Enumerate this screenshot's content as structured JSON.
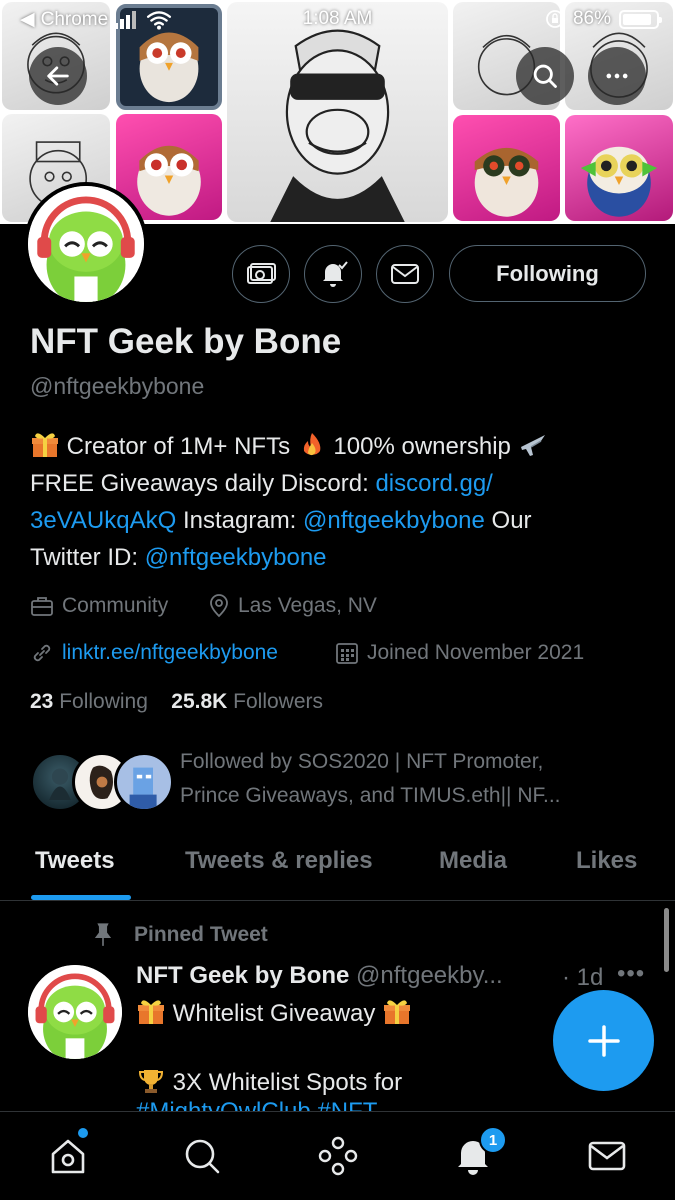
{
  "status_bar": {
    "back_app": "Chrome",
    "time": "1:08 AM",
    "battery": "86%",
    "battery_level": 0.86
  },
  "profile": {
    "name": "NFT Geek by Bone",
    "handle": "@nftgeekbybone",
    "following_button": "Following",
    "bio": {
      "line1_text1": "Creator of 1M+ NFTs",
      "line1_text2": "100% ownership",
      "line2_text": "FREE Giveaways daily Discord:",
      "discord_link_part1": "discord.gg/",
      "discord_link_part2": "3eVAUkqAkQ",
      "instagram_label": "Instagram:",
      "instagram_handle": "@nftgeekbybone",
      "our_label": "Our",
      "twitter_label": "Twitter ID:",
      "twitter_handle": "@nftgeekbybone"
    },
    "category": "Community",
    "location": "Las Vegas, NV",
    "website": "linktr.ee/nftgeekbybone",
    "joined": "Joined November 2021",
    "following_count": "23",
    "following_label": "Following",
    "followers_count": "25.8K",
    "followers_label": "Followers",
    "followed_by_line1": "Followed by SOS2020 | NFT Promoter,",
    "followed_by_line2": "Prince Giveaways, and TIMUS.eth|| NF..."
  },
  "tabs": [
    {
      "label": "Tweets",
      "active": true
    },
    {
      "label": "Tweets & replies",
      "active": false
    },
    {
      "label": "Media",
      "active": false
    },
    {
      "label": "Likes",
      "active": false
    }
  ],
  "pinned_tweet": {
    "pinned_label": "Pinned Tweet",
    "author_name": "NFT Geek by Bone",
    "author_handle": "@nftgeekby...",
    "time": "· 1d",
    "more": "•••",
    "line1": "Whitelist Giveaway",
    "line2": "3X Whitelist Spots for",
    "line3": "#MightyOwlClub #NFT"
  },
  "bottom_nav": {
    "notifications_badge": "1"
  },
  "colors": {
    "accent": "#1d9bf0",
    "muted": "#71767b",
    "text": "#e7e9ea",
    "background": "#000000"
  }
}
